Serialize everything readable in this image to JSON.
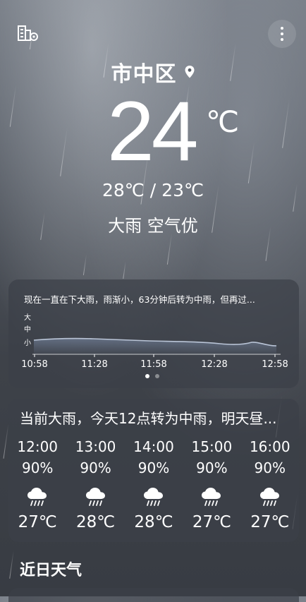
{
  "header": {
    "city": "市中区",
    "temperature": "24",
    "unit": "℃",
    "range": "28℃ / 23℃",
    "condition": "大雨  空气优"
  },
  "minute_rain": {
    "alert": "现在一直在下大雨，雨渐小，63分钟后转为中雨，但再过...",
    "levels": [
      "大",
      "中",
      "小"
    ],
    "times": [
      "10:58",
      "11:28",
      "11:58",
      "12:28",
      "12:58"
    ],
    "page_count": 2,
    "active_page": 0
  },
  "hourly": {
    "summary": "当前大雨，今天12点转为中雨，明天昼...",
    "items": [
      {
        "time": "12:00",
        "precip": "90%",
        "icon": "light-rain-cloud-icon",
        "temp": "27℃"
      },
      {
        "time": "13:00",
        "precip": "90%",
        "icon": "light-rain-cloud-icon",
        "temp": "28℃"
      },
      {
        "time": "14:00",
        "precip": "90%",
        "icon": "light-rain-cloud-icon",
        "temp": "28℃"
      },
      {
        "time": "15:00",
        "precip": "90%",
        "icon": "light-rain-cloud-icon",
        "temp": "27℃"
      },
      {
        "time": "16:00",
        "precip": "90%",
        "icon": "light-rain-cloud-icon",
        "temp": "27℃"
      }
    ]
  },
  "forecast": {
    "title": "近日天气"
  },
  "colors": {
    "card_bg": "#3c4048",
    "line": "#b9c4d6",
    "accent": "#ffffff"
  }
}
